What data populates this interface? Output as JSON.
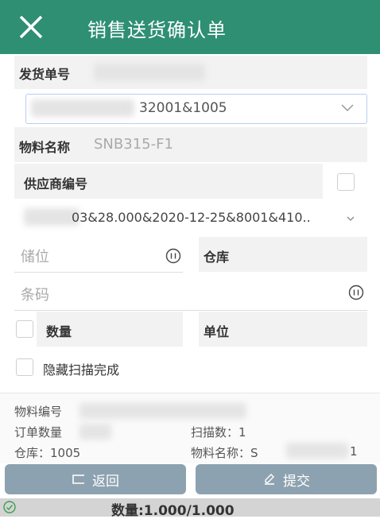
{
  "header": {
    "title": "销售送货确认单"
  },
  "form": {
    "delivery_no_label": "发货单号",
    "delivery_select_value": "32001&1005",
    "material_name_label": "物料名称",
    "material_name_value": "SNB315-F1",
    "supplier_code_label": "供应商编号",
    "batch_select_value": "03&28.000&2020-12-25&8001&410..",
    "location_placeholder": "储位",
    "warehouse_label": "仓库",
    "barcode_placeholder": "条码",
    "quantity_label": "数量",
    "unit_label": "单位",
    "hide_scanned_label": "隐藏扫描完成"
  },
  "info": {
    "material_code_label": "物料编号",
    "order_qty_label": "订单数量",
    "scan_count": "扫描数：1",
    "warehouse": "仓库：1005",
    "material_name_prefix": "物料名称：S",
    "material_name_suffix": "1"
  },
  "buttons": {
    "back_label": "返回",
    "submit_label": "提交"
  },
  "status": {
    "quantity_text": "数量:1.000/1.000"
  },
  "colors": {
    "header": "#2e8f73",
    "button": "#8da2b0",
    "status_bar": "#d4d4d4"
  }
}
